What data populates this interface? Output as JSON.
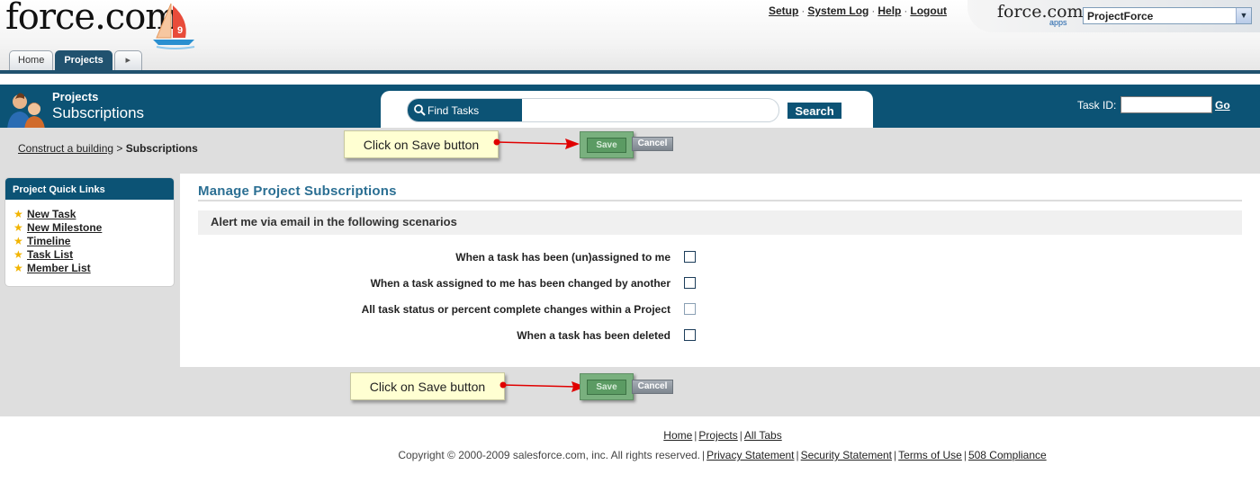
{
  "header": {
    "logo_text": "force.com",
    "logo_release": "9",
    "top_links": [
      "Setup",
      "System Log",
      "Help",
      "Logout"
    ],
    "apps_logo": "force.com",
    "apps_sub": "apps",
    "app_selector_value": "ProjectForce"
  },
  "tabs": [
    {
      "label": "Home",
      "active": false
    },
    {
      "label": "Projects",
      "active": true
    }
  ],
  "banner": {
    "page_type": "Projects",
    "page_title": "Subscriptions",
    "find_label": "Find Tasks",
    "find_value": "",
    "search_label": "Search",
    "task_id_label": "Task ID:",
    "task_id_value": "",
    "go_label": "Go"
  },
  "breadcrumb": {
    "parent": "Construct a building",
    "separator": ">",
    "current": "Subscriptions"
  },
  "annotations": {
    "callout_text": "Click on Save button",
    "arrow_color": "#e00000"
  },
  "buttons": {
    "save_label": "Save",
    "cancel_label": "Cancel"
  },
  "quick_links": {
    "title": "Project Quick Links",
    "items": [
      "New Task",
      "New Milestone",
      "Timeline",
      "Task List",
      "Member List"
    ]
  },
  "main": {
    "section_title": "Manage Project Subscriptions",
    "alert_heading": "Alert me via email in the following scenarios",
    "options": [
      {
        "label": "When a task has been (un)assigned to me",
        "checked": false
      },
      {
        "label": "When a task assigned to me has been changed by another",
        "checked": false
      },
      {
        "label": "All task status or percent complete changes within a Project",
        "checked": false
      },
      {
        "label": "When a task has been deleted",
        "checked": false
      }
    ]
  },
  "footer": {
    "links": [
      "Home",
      "Projects",
      "All Tabs"
    ],
    "copyright": "Copyright © 2000-2009 salesforce.com, inc. All rights reserved.",
    "legal_links": [
      "Privacy Statement",
      "Security Statement",
      "Terms of Use",
      "508 Compliance"
    ]
  },
  "colors": {
    "brand_dark": "#0c5375",
    "section_title": "#2b6f93",
    "save_green": "#5b9b63"
  }
}
